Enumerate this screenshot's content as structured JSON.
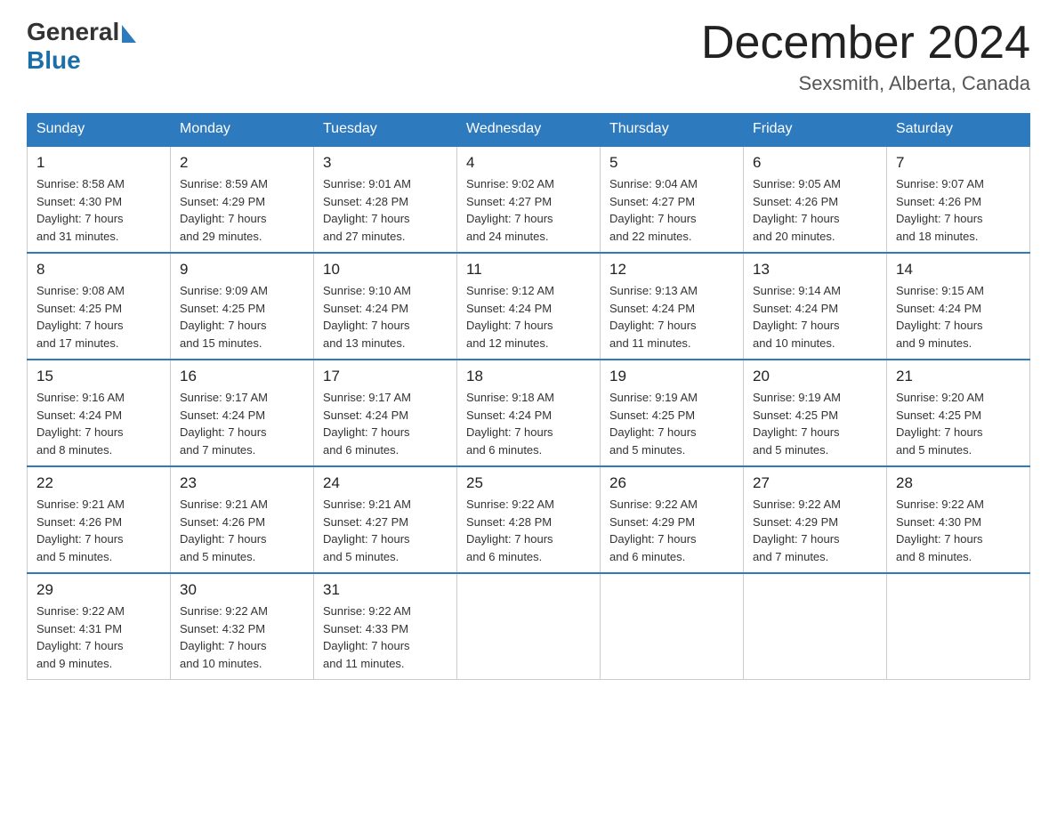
{
  "logo": {
    "general": "General",
    "blue": "Blue"
  },
  "header": {
    "month": "December 2024",
    "location": "Sexsmith, Alberta, Canada"
  },
  "days_of_week": [
    "Sunday",
    "Monday",
    "Tuesday",
    "Wednesday",
    "Thursday",
    "Friday",
    "Saturday"
  ],
  "weeks": [
    [
      {
        "day": "1",
        "info": "Sunrise: 8:58 AM\nSunset: 4:30 PM\nDaylight: 7 hours\nand 31 minutes."
      },
      {
        "day": "2",
        "info": "Sunrise: 8:59 AM\nSunset: 4:29 PM\nDaylight: 7 hours\nand 29 minutes."
      },
      {
        "day": "3",
        "info": "Sunrise: 9:01 AM\nSunset: 4:28 PM\nDaylight: 7 hours\nand 27 minutes."
      },
      {
        "day": "4",
        "info": "Sunrise: 9:02 AM\nSunset: 4:27 PM\nDaylight: 7 hours\nand 24 minutes."
      },
      {
        "day": "5",
        "info": "Sunrise: 9:04 AM\nSunset: 4:27 PM\nDaylight: 7 hours\nand 22 minutes."
      },
      {
        "day": "6",
        "info": "Sunrise: 9:05 AM\nSunset: 4:26 PM\nDaylight: 7 hours\nand 20 minutes."
      },
      {
        "day": "7",
        "info": "Sunrise: 9:07 AM\nSunset: 4:26 PM\nDaylight: 7 hours\nand 18 minutes."
      }
    ],
    [
      {
        "day": "8",
        "info": "Sunrise: 9:08 AM\nSunset: 4:25 PM\nDaylight: 7 hours\nand 17 minutes."
      },
      {
        "day": "9",
        "info": "Sunrise: 9:09 AM\nSunset: 4:25 PM\nDaylight: 7 hours\nand 15 minutes."
      },
      {
        "day": "10",
        "info": "Sunrise: 9:10 AM\nSunset: 4:24 PM\nDaylight: 7 hours\nand 13 minutes."
      },
      {
        "day": "11",
        "info": "Sunrise: 9:12 AM\nSunset: 4:24 PM\nDaylight: 7 hours\nand 12 minutes."
      },
      {
        "day": "12",
        "info": "Sunrise: 9:13 AM\nSunset: 4:24 PM\nDaylight: 7 hours\nand 11 minutes."
      },
      {
        "day": "13",
        "info": "Sunrise: 9:14 AM\nSunset: 4:24 PM\nDaylight: 7 hours\nand 10 minutes."
      },
      {
        "day": "14",
        "info": "Sunrise: 9:15 AM\nSunset: 4:24 PM\nDaylight: 7 hours\nand 9 minutes."
      }
    ],
    [
      {
        "day": "15",
        "info": "Sunrise: 9:16 AM\nSunset: 4:24 PM\nDaylight: 7 hours\nand 8 minutes."
      },
      {
        "day": "16",
        "info": "Sunrise: 9:17 AM\nSunset: 4:24 PM\nDaylight: 7 hours\nand 7 minutes."
      },
      {
        "day": "17",
        "info": "Sunrise: 9:17 AM\nSunset: 4:24 PM\nDaylight: 7 hours\nand 6 minutes."
      },
      {
        "day": "18",
        "info": "Sunrise: 9:18 AM\nSunset: 4:24 PM\nDaylight: 7 hours\nand 6 minutes."
      },
      {
        "day": "19",
        "info": "Sunrise: 9:19 AM\nSunset: 4:25 PM\nDaylight: 7 hours\nand 5 minutes."
      },
      {
        "day": "20",
        "info": "Sunrise: 9:19 AM\nSunset: 4:25 PM\nDaylight: 7 hours\nand 5 minutes."
      },
      {
        "day": "21",
        "info": "Sunrise: 9:20 AM\nSunset: 4:25 PM\nDaylight: 7 hours\nand 5 minutes."
      }
    ],
    [
      {
        "day": "22",
        "info": "Sunrise: 9:21 AM\nSunset: 4:26 PM\nDaylight: 7 hours\nand 5 minutes."
      },
      {
        "day": "23",
        "info": "Sunrise: 9:21 AM\nSunset: 4:26 PM\nDaylight: 7 hours\nand 5 minutes."
      },
      {
        "day": "24",
        "info": "Sunrise: 9:21 AM\nSunset: 4:27 PM\nDaylight: 7 hours\nand 5 minutes."
      },
      {
        "day": "25",
        "info": "Sunrise: 9:22 AM\nSunset: 4:28 PM\nDaylight: 7 hours\nand 6 minutes."
      },
      {
        "day": "26",
        "info": "Sunrise: 9:22 AM\nSunset: 4:29 PM\nDaylight: 7 hours\nand 6 minutes."
      },
      {
        "day": "27",
        "info": "Sunrise: 9:22 AM\nSunset: 4:29 PM\nDaylight: 7 hours\nand 7 minutes."
      },
      {
        "day": "28",
        "info": "Sunrise: 9:22 AM\nSunset: 4:30 PM\nDaylight: 7 hours\nand 8 minutes."
      }
    ],
    [
      {
        "day": "29",
        "info": "Sunrise: 9:22 AM\nSunset: 4:31 PM\nDaylight: 7 hours\nand 9 minutes."
      },
      {
        "day": "30",
        "info": "Sunrise: 9:22 AM\nSunset: 4:32 PM\nDaylight: 7 hours\nand 10 minutes."
      },
      {
        "day": "31",
        "info": "Sunrise: 9:22 AM\nSunset: 4:33 PM\nDaylight: 7 hours\nand 11 minutes."
      },
      {
        "day": "",
        "info": ""
      },
      {
        "day": "",
        "info": ""
      },
      {
        "day": "",
        "info": ""
      },
      {
        "day": "",
        "info": ""
      }
    ]
  ]
}
